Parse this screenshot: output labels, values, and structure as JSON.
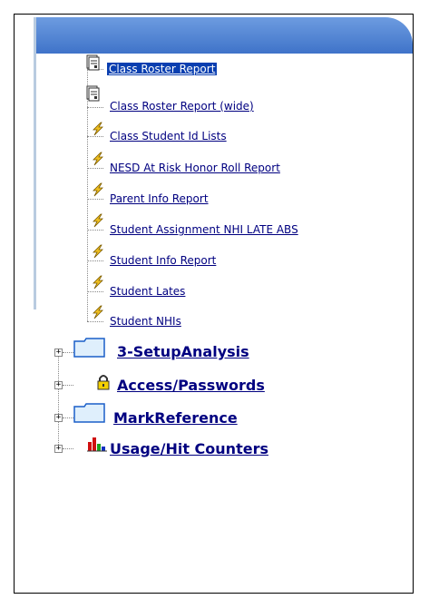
{
  "reports": [
    {
      "label": "Class Roster Report",
      "icon": "report-doc-icon",
      "selected": true
    },
    {
      "label": "Class Roster Report (wide)",
      "icon": "report-doc-icon",
      "selected": false
    },
    {
      "label": "Class Student Id Lists",
      "icon": "lightning-icon",
      "selected": false
    },
    {
      "label": "NESD At Risk Honor Roll Report",
      "icon": "lightning-icon",
      "selected": false
    },
    {
      "label": "Parent Info Report",
      "icon": "lightning-icon",
      "selected": false
    },
    {
      "label": "Student Assignment NHI LATE ABS",
      "icon": "lightning-icon",
      "selected": false
    },
    {
      "label": "Student Info Report",
      "icon": "lightning-icon",
      "selected": false
    },
    {
      "label": "Student Lates",
      "icon": "lightning-icon",
      "selected": false
    },
    {
      "label": "Student NHIs",
      "icon": "lightning-icon",
      "selected": false
    }
  ],
  "folders": [
    {
      "label": "3-SetupAnalysis",
      "icon": "folder-icon",
      "expander": "+"
    },
    {
      "label": "Access/Passwords",
      "icon": "lock-icon",
      "expander": "+"
    },
    {
      "label": "MarkReference",
      "icon": "folder-icon",
      "expander": "+"
    },
    {
      "label": "Usage/Hit Counters",
      "icon": "bar-chart-icon",
      "expander": "+"
    }
  ],
  "colors": {
    "header": "#4a7fd4",
    "link": "#000080",
    "selected_bg": "#0a3fb0"
  }
}
